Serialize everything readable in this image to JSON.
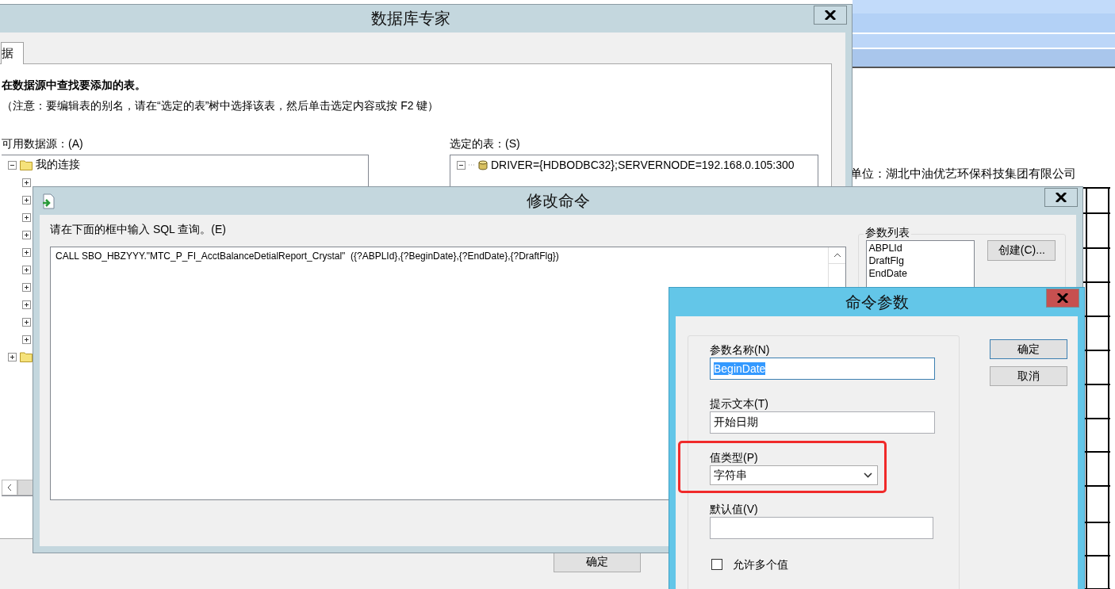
{
  "report": {
    "company": "单位：湖北中油优艺环保科技集团有限公司"
  },
  "database_expert": {
    "title": "数据库专家",
    "tabs": [
      {
        "label": "据",
        "selected": true
      }
    ],
    "instruction": "在数据源中查找要添加的表。",
    "note": "（注意：要编辑表的别名，请在“选定的表”树中选择该表，然后单击选定内容或按 F2 键）",
    "available": {
      "label": "可用数据源：(A)",
      "tree": [
        {
          "kind": "folder",
          "label": "我的连接",
          "expanded": true,
          "children": [
            {
              "expanded": false
            },
            {
              "expanded": false
            },
            {
              "expanded": false
            },
            {
              "expanded": false
            },
            {
              "expanded": false
            },
            {
              "expanded": false
            },
            {
              "expanded": false
            },
            {
              "expanded": false
            },
            {
              "expanded": false
            },
            {
              "expanded": false
            }
          ]
        },
        {
          "kind": "folder",
          "expanded": false
        }
      ]
    },
    "selected": {
      "label": "选定的表：(S)",
      "tree": [
        {
          "kind": "database",
          "label": "DRIVER={HDBODBC32};SERVERNODE=192.168.0.105:300",
          "expanded": true
        }
      ]
    },
    "buttons": [
      "确定"
    ]
  },
  "edit_command": {
    "title": "修改命令",
    "prompt": "请在下面的框中输入 SQL 查询。(E)",
    "sql": "CALL SBO_HBZYYY.\"MTC_P_FI_AcctBalanceDetialReport_Crystal\"  ({?ABPLId},{?BeginDate},{?EndDate},{?DraftFlg})",
    "parameters": {
      "label": "参数列表",
      "items": [
        "ABPLId",
        "DraftFlg",
        "EndDate"
      ],
      "buttons": [
        "创建(C)..."
      ]
    }
  },
  "command_parameters": {
    "title": "命令参数",
    "fields": [
      {
        "kind": "text",
        "label": "参数名称(N)",
        "value": "BeginDate",
        "highlighted": true
      },
      {
        "kind": "text",
        "label": "提示文本(T)",
        "value": "开始日期",
        "highlighted": false
      },
      {
        "kind": "select",
        "label": "值类型(P)",
        "value": "字符串",
        "annotated": true
      },
      {
        "kind": "text",
        "label": "默认值(V)",
        "highlighted": false
      },
      {
        "kind": "checkbox",
        "label": "允许多个值",
        "checked": false
      }
    ],
    "buttons": [
      {
        "label": "确定",
        "default": true
      },
      {
        "label": "取消",
        "default": false
      }
    ]
  }
}
